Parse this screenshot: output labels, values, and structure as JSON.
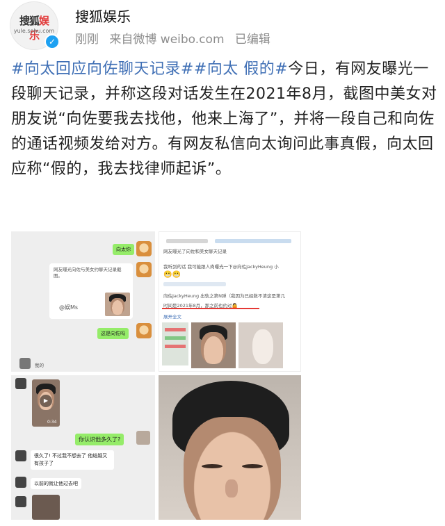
{
  "header": {
    "avatar_logo_main": "搜狐",
    "avatar_logo_accent": "娱乐",
    "avatar_logo_url": "yule.sohu.com",
    "verified_icon": "checkmark",
    "author": "搜狐娱乐",
    "meta": {
      "time": "刚刚",
      "source": "来自微博 weibo.com",
      "edited": "已编辑"
    },
    "colors": {
      "link": "#3f6fb5",
      "meta": "#8e8e8e",
      "verified": "#1da1f2"
    }
  },
  "post": {
    "tag1": "#向太回应向佐聊天记录#",
    "tag2": "#向太 假的#",
    "body": "今日，有网友曝光一段聊天记录，并称这段对话发生在2021年8月，截图中美女对朋友说“向佐要我去找他，他来上海了”，并将一段自己和向佐的通话视频发给对方。有网友私信向太询问此事真假，向太回应称“假的，我去找律师起诉”。"
  },
  "images": {
    "img1": {
      "bubble_top": "向太你",
      "card_line": "网友曝光向佐与美女约聊天记录截图。",
      "card_tag": "@娱Ms",
      "bubble_bottom": "这是向佐吗",
      "reply": "我的"
    },
    "img2": {
      "line1": "网友曝光了向佐和美女聊天记录",
      "line2": "我听到的话 我可能跟人肉曝光一下@向佐JackyHeung 小",
      "line3": "向佐JackyHeung 出轨之第N弹（我因为已经数不清这是第几",
      "line4": "时间是2021年8月，那之前也约过🤷",
      "line5": "展开全文"
    },
    "img3": {
      "video_duration": "0:34",
      "q": "你认识他多久了?",
      "a1": "很久了! 不过我不想去了 他结婚又有孩子了",
      "a2": "以前的就让他过去吧"
    }
  }
}
